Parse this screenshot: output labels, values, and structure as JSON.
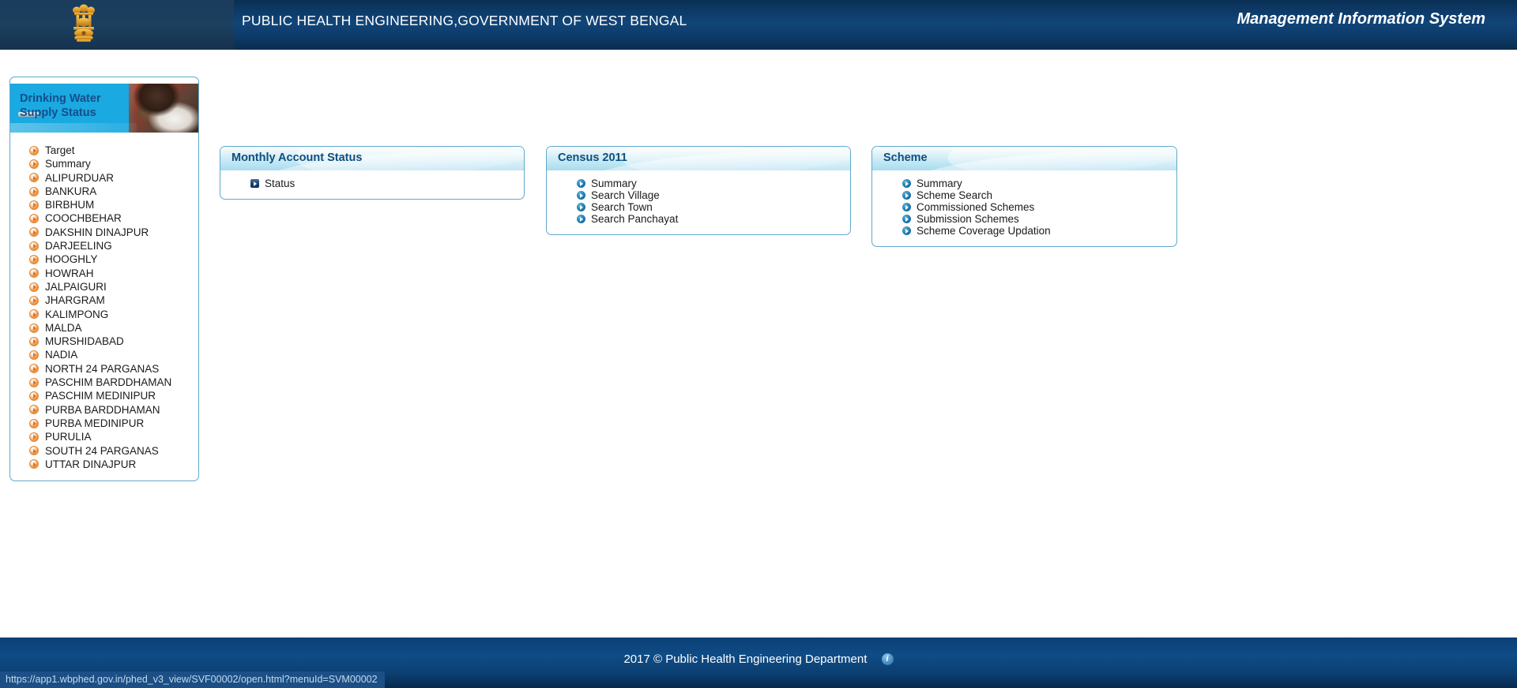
{
  "header": {
    "emblem_alt": "national-emblem-of-india",
    "title": "PUBLIC HEALTH ENGINEERING,GOVERNMENT OF WEST BENGAL",
    "mis_label": "Management Information System"
  },
  "sidebar": {
    "banner_text": "Drinking Water\nSupply Status",
    "items": [
      {
        "label": "Target"
      },
      {
        "label": "Summary"
      },
      {
        "label": "ALIPURDUAR"
      },
      {
        "label": "BANKURA"
      },
      {
        "label": "BIRBHUM"
      },
      {
        "label": "COOCHBEHAR"
      },
      {
        "label": "DAKSHIN DINAJPUR"
      },
      {
        "label": "DARJEELING"
      },
      {
        "label": "HOOGHLY"
      },
      {
        "label": "HOWRAH"
      },
      {
        "label": "JALPAIGURI"
      },
      {
        "label": "JHARGRAM"
      },
      {
        "label": "KALIMPONG"
      },
      {
        "label": "MALDA"
      },
      {
        "label": "MURSHIDABAD"
      },
      {
        "label": "NADIA"
      },
      {
        "label": "NORTH 24 PARGANAS"
      },
      {
        "label": "PASCHIM BARDDHAMAN"
      },
      {
        "label": "PASCHIM MEDINIPUR"
      },
      {
        "label": "PURBA BARDDHAMAN"
      },
      {
        "label": "PURBA MEDINIPUR"
      },
      {
        "label": "PURULIA"
      },
      {
        "label": "SOUTH 24 PARGANAS"
      },
      {
        "label": "UTTAR DINAJPUR"
      }
    ]
  },
  "panels": {
    "monthly": {
      "title": "Monthly Account Status",
      "items": [
        {
          "label": "Status"
        }
      ]
    },
    "census": {
      "title": "Census 2011",
      "items": [
        {
          "label": "Summary"
        },
        {
          "label": "Search Village"
        },
        {
          "label": "Search Town"
        },
        {
          "label": "Search Panchayat"
        }
      ]
    },
    "scheme": {
      "title": "Scheme",
      "items": [
        {
          "label": "Summary"
        },
        {
          "label": "Scheme Search"
        },
        {
          "label": "Commissioned Schemes"
        },
        {
          "label": "Submission Schemes"
        },
        {
          "label": "Scheme Coverage Updation"
        }
      ]
    }
  },
  "footer": {
    "copyright": "2017 © Public Health Engineering Department",
    "info_icon": "info-icon"
  },
  "statusbar": {
    "url": "https://app1.wbphed.gov.in/phed_v3_view/SVF00002/open.html?menuId=SVM00002"
  },
  "colors": {
    "header_blue": "#114579",
    "panel_border": "#5fa9cb",
    "panel_title": "#0d4f7e",
    "banner_cyan": "#1aa9e0",
    "footer_blue": "#0f4c86",
    "orange_icon": "#e2741f",
    "blue_icon": "#1d79ad"
  }
}
